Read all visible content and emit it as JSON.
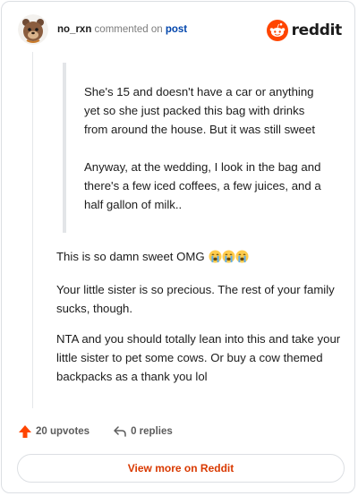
{
  "header": {
    "username": "no_rxn",
    "commented_text": "commented on",
    "post_link": "post",
    "logo_text": "reddit"
  },
  "quote": {
    "paragraphs": [
      "She's 15 and doesn't have a car or anything yet so she just packed this bag with drinks from around the house. But it was still sweet",
      "Anyway, at the wedding, I look in the bag and there's a few iced coffees, a few juices, and a half gallon of milk.."
    ]
  },
  "comment": {
    "paragraphs": [
      "This is so damn sweet OMG",
      "Your little sister is so precious. The rest of your family sucks, though.",
      "NTA and you should totally lean into this and take your little sister to pet some cows. Or buy a cow themed backpacks as a thank you lol"
    ],
    "emoji_name": "loudly-crying-face",
    "emoji_count": 3
  },
  "actions": {
    "upvotes": "20 upvotes",
    "replies": "0 replies"
  },
  "footer": {
    "view_more": "View more on Reddit"
  },
  "colors": {
    "reddit_orange": "#ff4500",
    "link_blue": "#0045ac",
    "view_more_text": "#d93900"
  }
}
